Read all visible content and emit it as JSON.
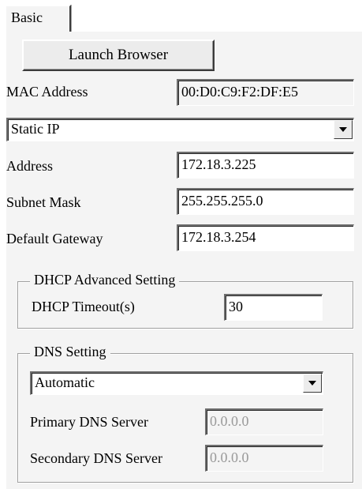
{
  "tabs": {
    "active": "Basic"
  },
  "launch_browser": {
    "label": "Launch Browser"
  },
  "mac": {
    "label": "MAC Address",
    "value": "00:D0:C9:F2:DF:E5"
  },
  "ip_mode": {
    "selected": "Static IP"
  },
  "address": {
    "label": "Address",
    "value": "172.18.3.225"
  },
  "subnet": {
    "label": "Subnet Mask",
    "value": "255.255.255.0"
  },
  "gateway": {
    "label": "Default Gateway",
    "value": "172.18.3.254"
  },
  "dhcp": {
    "title": "DHCP Advanced Setting",
    "timeout_label": "DHCP Timeout(s)",
    "timeout_value": "30"
  },
  "dns": {
    "title": "DNS Setting",
    "mode_selected": "Automatic",
    "primary_label": "Primary DNS Server",
    "primary_value": "0.0.0.0",
    "secondary_label": "Secondary DNS Server",
    "secondary_value": "0.0.0.0"
  },
  "colors": {
    "panel_background": "#f4f4f4",
    "field_background": "#ffffff",
    "disabled_text": "#9a9a9a"
  },
  "icons": {
    "dropdown": "chevron-down-icon"
  }
}
